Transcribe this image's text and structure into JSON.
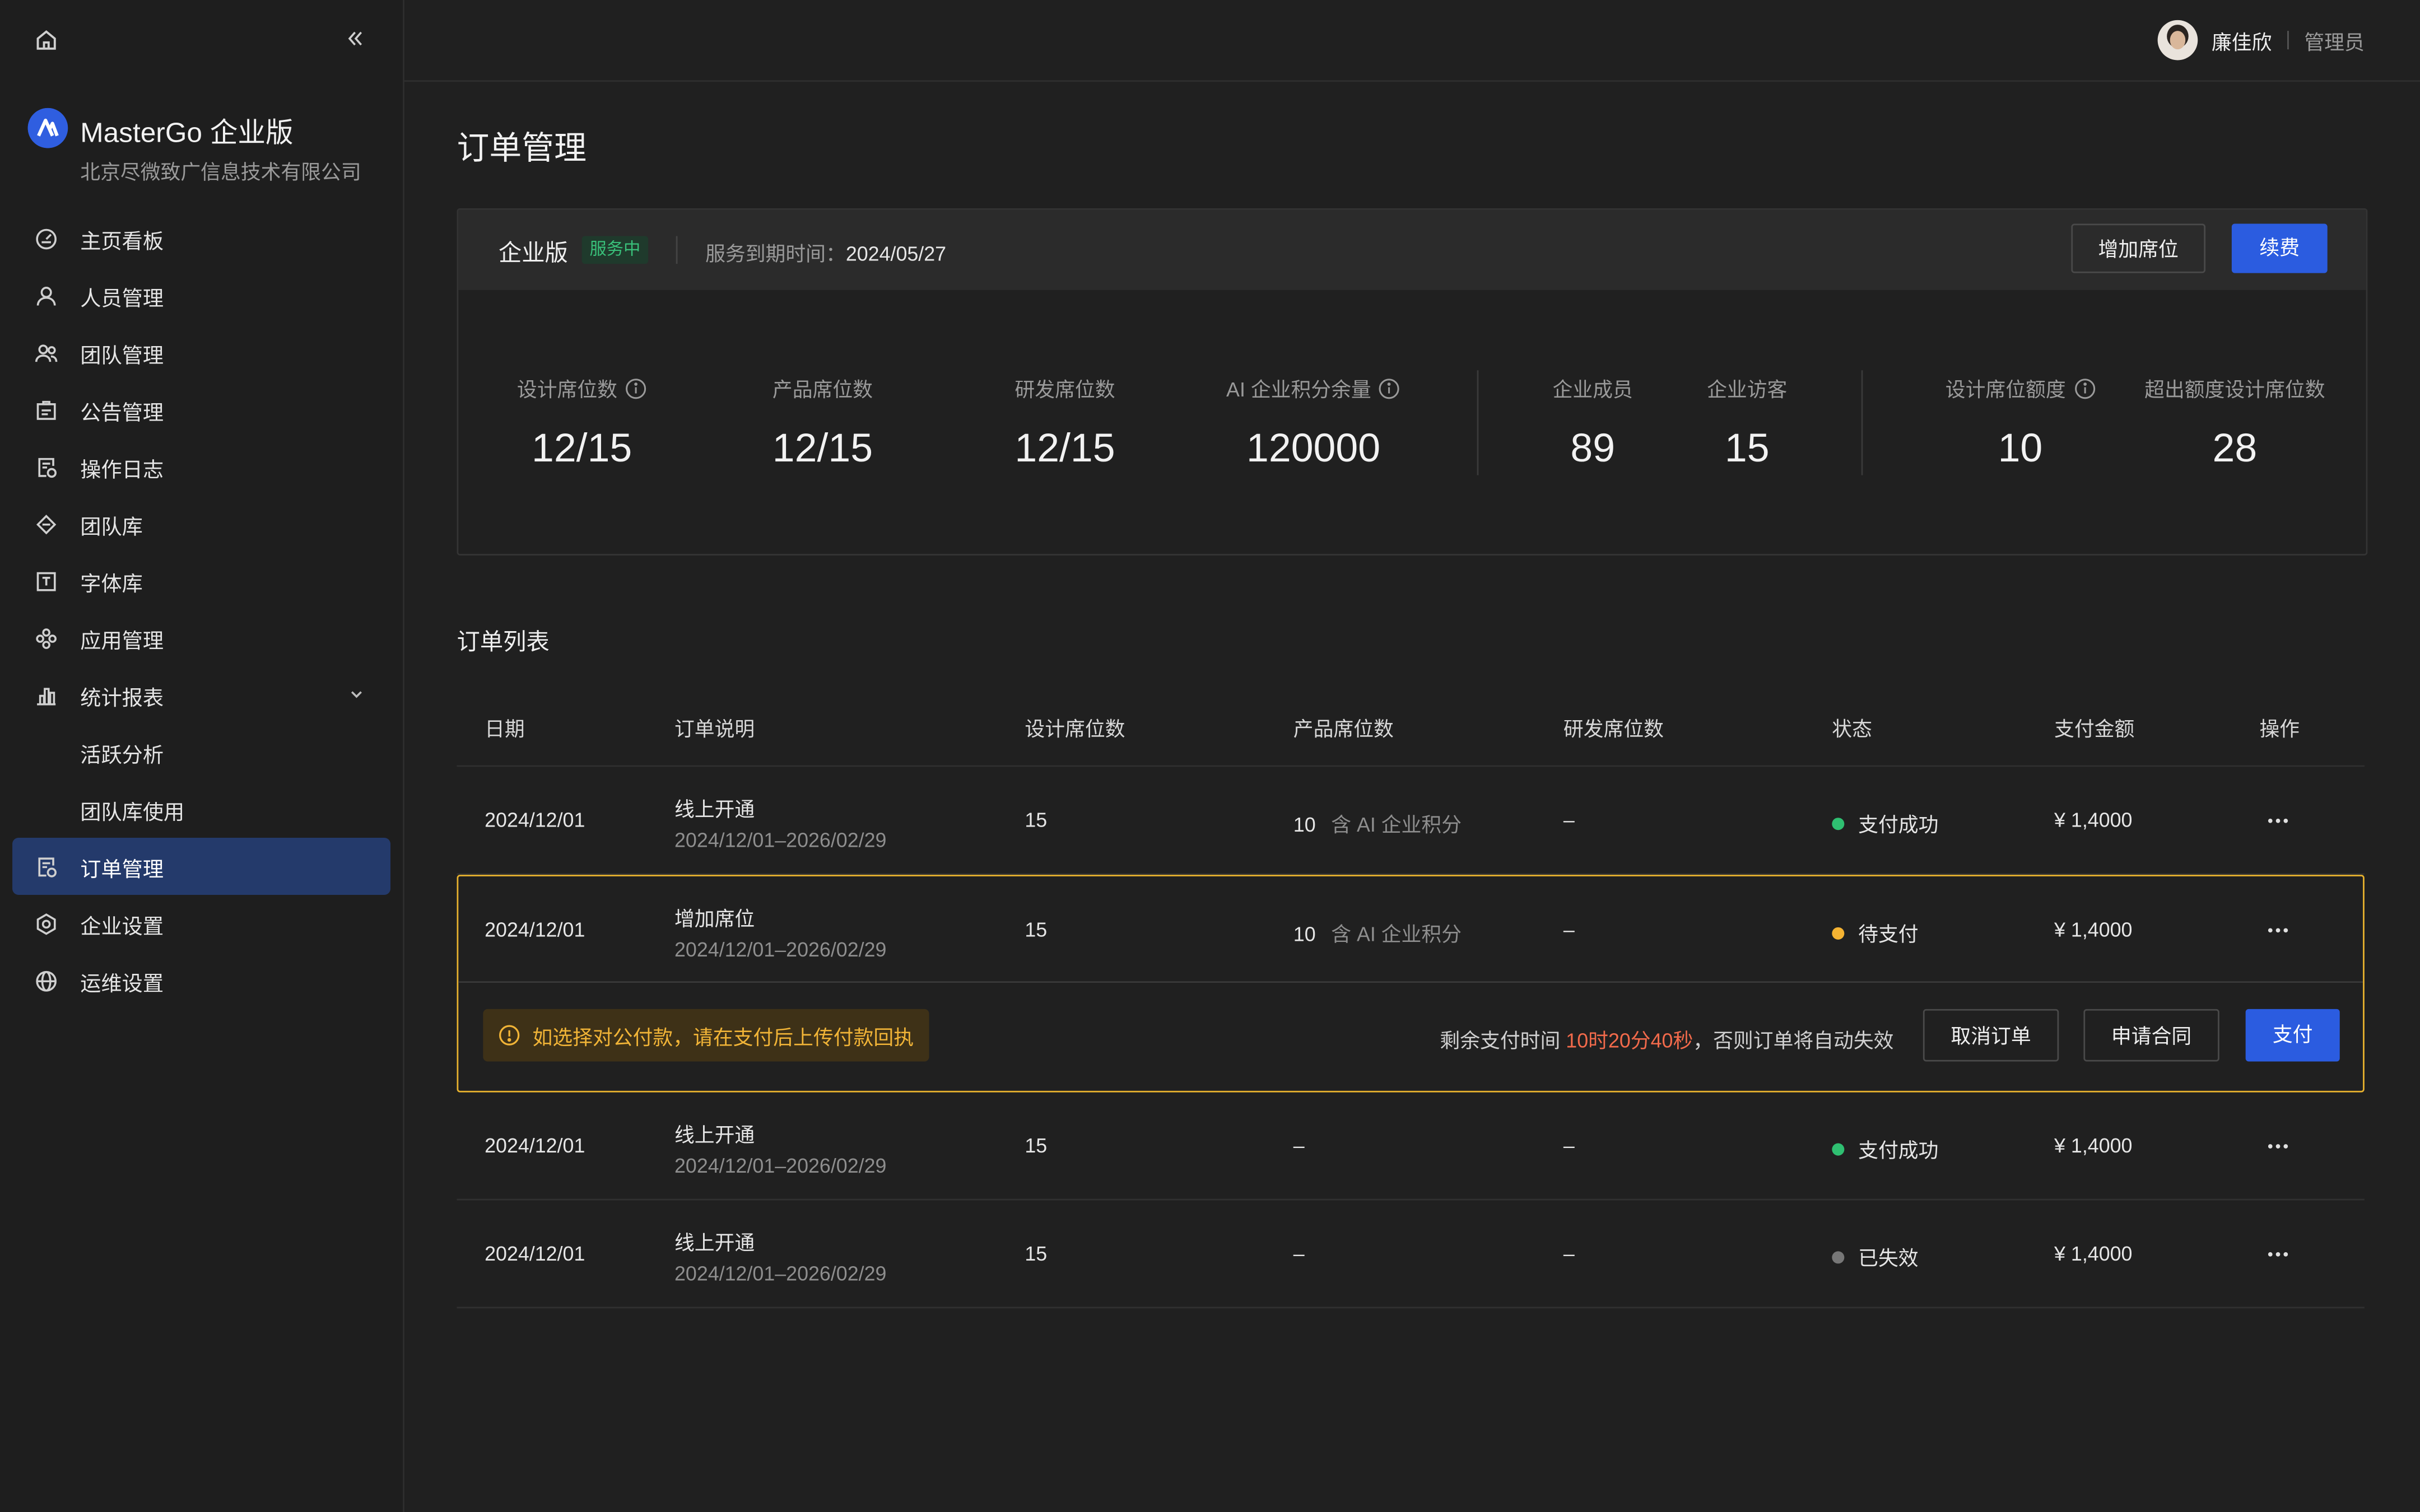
{
  "sidebar": {
    "brand_name": "MasterGo 企业版",
    "company": "北京尽微致广信息技术有限公司",
    "items": [
      {
        "label": "主页看板",
        "icon": "dashboard-icon"
      },
      {
        "label": "人员管理",
        "icon": "user-icon"
      },
      {
        "label": "团队管理",
        "icon": "team-icon"
      },
      {
        "label": "公告管理",
        "icon": "announcement-icon"
      },
      {
        "label": "操作日志",
        "icon": "log-icon"
      },
      {
        "label": "团队库",
        "icon": "library-icon"
      },
      {
        "label": "字体库",
        "icon": "font-icon"
      },
      {
        "label": "应用管理",
        "icon": "apps-icon"
      },
      {
        "label": "统计报表",
        "icon": "chart-icon"
      },
      {
        "label": "活跃分析"
      },
      {
        "label": "团队库使用"
      },
      {
        "label": "订单管理",
        "icon": "order-icon"
      },
      {
        "label": "企业设置",
        "icon": "settings-icon"
      },
      {
        "label": "运维设置",
        "icon": "globe-icon"
      }
    ],
    "active_index": 11
  },
  "header": {
    "user_name": "廉佳欣",
    "user_role": "管理员"
  },
  "page": {
    "title": "订单管理"
  },
  "plan": {
    "name": "企业版",
    "status_badge": "服务中",
    "expire_label": "服务到期时间：",
    "expire_date": "2024/05/27",
    "add_seat_button": "增加席位",
    "renew_button": "续费",
    "stats": [
      {
        "label": "设计席位数",
        "value": "12/15"
      },
      {
        "label": "产品席位数",
        "value": "12/15"
      },
      {
        "label": "研发席位数",
        "value": "12/15"
      },
      {
        "label": "AI 企业积分余量",
        "value": "120000"
      },
      {
        "label": "企业成员",
        "value": "89"
      },
      {
        "label": "企业访客",
        "value": "15"
      },
      {
        "label": "设计席位额度",
        "value": "10"
      },
      {
        "label": "超出额度设计席位数",
        "value": "28"
      }
    ]
  },
  "orders": {
    "title": "订单列表",
    "columns": [
      "日期",
      "订单说明",
      "设计席位数",
      "产品席位数",
      "研发席位数",
      "状态",
      "支付金额",
      "操作"
    ],
    "ai_tag": "含 AI 企业积分",
    "rows": [
      {
        "date": "2024/12/01",
        "desc": "线上开通",
        "period": "2024/12/01–2026/02/29",
        "design": "15",
        "product": "10",
        "dev": "–",
        "status": "支付成功",
        "status_color": "#2fbf71",
        "amount": "¥ 1,4000"
      },
      {
        "date": "2024/12/01",
        "desc": "增加席位",
        "period": "2024/12/01–2026/02/29",
        "design": "15",
        "product": "10",
        "dev": "–",
        "status": "待支付",
        "status_color": "#f5b332",
        "amount": "¥ 1,4000"
      },
      {
        "date": "2024/12/01",
        "desc": "线上开通",
        "period": "2024/12/01–2026/02/29",
        "design": "15",
        "product": "–",
        "dev": "–",
        "status": "支付成功",
        "status_color": "#2fbf71",
        "amount": "¥ 1,4000"
      },
      {
        "date": "2024/12/01",
        "desc": "线上开通",
        "period": "2024/12/01–2026/02/29",
        "design": "15",
        "product": "–",
        "dev": "–",
        "status": "已失效",
        "status_color": "#777777",
        "amount": "¥ 1,4000"
      }
    ],
    "pending": {
      "warning": "如选择对公付款，请在支付后上传付款回执",
      "remain_prefix": "剩余支付时间",
      "remain_time": "10时20分40秒",
      "remain_suffix": "，否则订单将自动失效",
      "cancel_button": "取消订单",
      "contract_button": "申请合同",
      "pay_button": "支付"
    }
  }
}
